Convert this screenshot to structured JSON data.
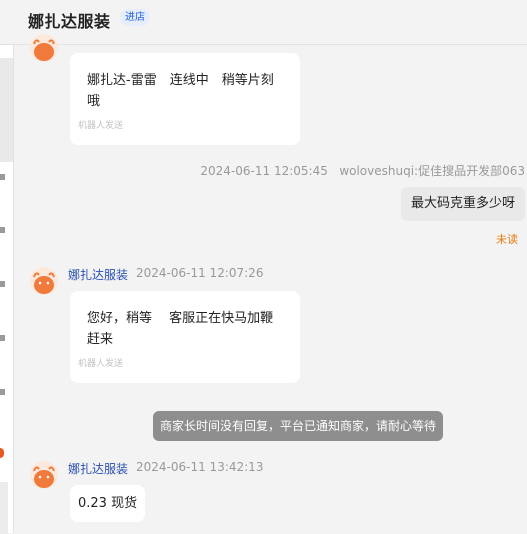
{
  "header": {
    "shop_name": "娜扎达服装",
    "enter_label": "进店"
  },
  "messages": [
    {
      "type": "shop",
      "text_line1": "娜扎达-雷雷　连线中　稍等片刻",
      "text_line2": "哦",
      "bot_tag": "机器人发送"
    },
    {
      "type": "user",
      "time": "2024-06-11 12:05:45",
      "sender": "woloveshuqi:促佳搜品开发部063",
      "text": "最大码克重多少呀",
      "status": "未读"
    },
    {
      "type": "shop",
      "sender": "娜扎达服装",
      "time": "2024-06-11 12:07:26",
      "text_line1": "您好，稍等　 客服正在快马加鞭",
      "text_line2": "赶来",
      "bot_tag": "机器人发送"
    },
    {
      "type": "system",
      "text": "商家长时间没有回复，平台已通知商家，请耐心等待"
    },
    {
      "type": "shop",
      "sender": "娜扎达服装",
      "time": "2024-06-11 13:42:13",
      "text": "0.23  现货"
    }
  ],
  "colors": {
    "accent_blue": "#2a4fb0",
    "unread_orange": "#e57c12",
    "avatar_orange": "#f07a3c"
  },
  "icons": {
    "avatar": "bull-head-avatar-icon"
  }
}
